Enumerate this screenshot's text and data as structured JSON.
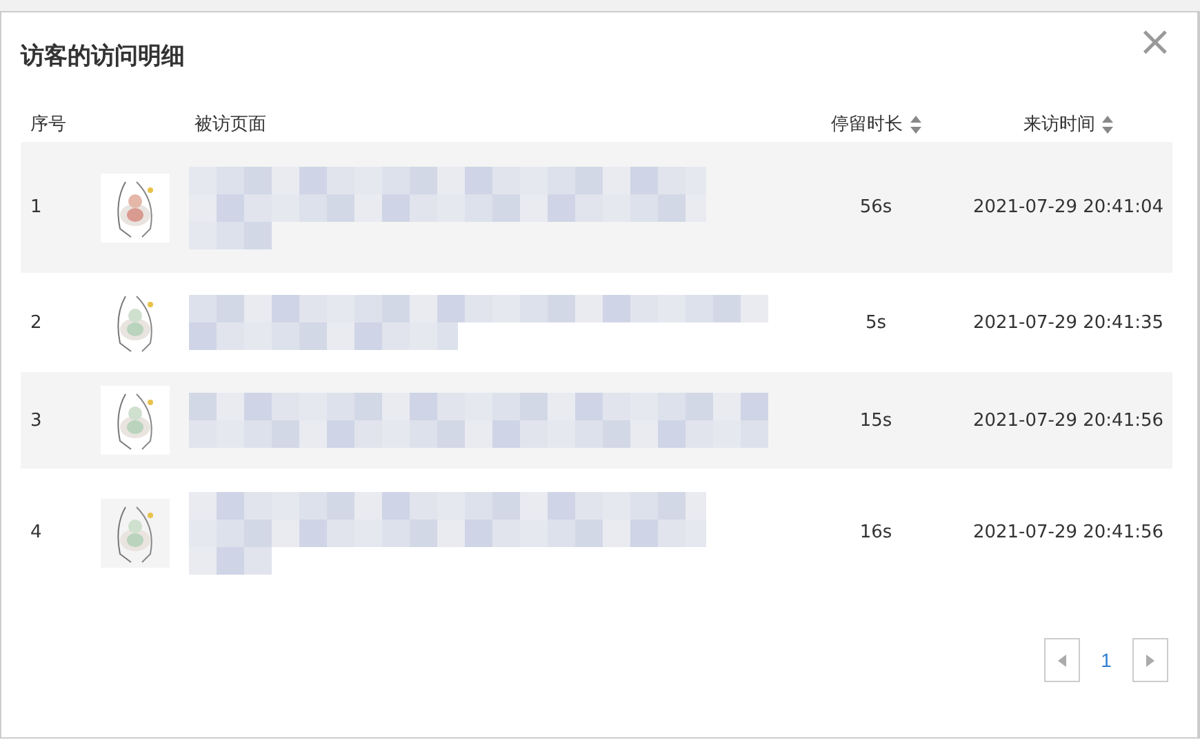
{
  "dialog": {
    "title": "访客的访问明细",
    "close": "×"
  },
  "table": {
    "columns": [
      {
        "label": "序号",
        "sortable": false
      },
      {
        "label": "被访页面",
        "sortable": false
      },
      {
        "label": "停留时长",
        "sortable": true
      },
      {
        "label": "来访时间",
        "sortable": true
      }
    ],
    "rows": [
      {
        "index": "1",
        "duration": "56s",
        "time": "2021-07-29 20:41:04"
      },
      {
        "index": "2",
        "duration": "5s",
        "time": "2021-07-29 20:41:35"
      },
      {
        "index": "3",
        "duration": "15s",
        "time": "2021-07-29 20:41:56"
      },
      {
        "index": "4",
        "duration": "16s",
        "time": "2021-07-29 20:41:56"
      }
    ]
  },
  "pagination": {
    "pages": [
      {
        "label": "1",
        "selected": true
      }
    ]
  }
}
